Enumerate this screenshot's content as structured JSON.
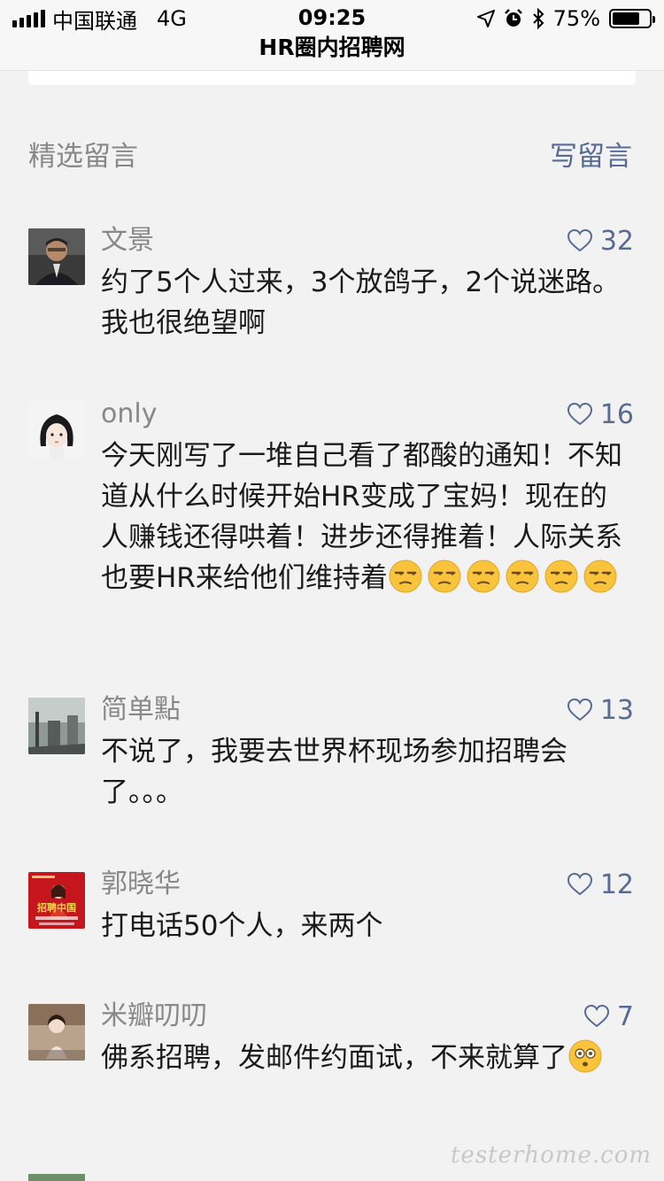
{
  "status_bar": {
    "carrier": "中国联通",
    "network": "4G",
    "time": "09:25",
    "battery": "75%",
    "battery_level": 0.75
  },
  "nav": {
    "title": "HR圈内招聘网"
  },
  "section": {
    "title": "精选留言",
    "write_label": "写留言"
  },
  "comments": [
    {
      "name": "文景",
      "likes": "32",
      "text": "约了5个人过来，3个放鸽子，2个说迷路。我也很绝望啊"
    },
    {
      "name": "only",
      "likes": "16",
      "text": "今天刚写了一堆自己看了都酸的通知！不知道从什么时候开始HR变成了宝妈！现在的人赚钱还得哄着！进步还得推着！人际关系也要HR来给他们维持着",
      "emoji": [
        "unamused-face",
        "unamused-face",
        "unamused-face",
        "unamused-face",
        "unamused-face",
        "unamused-face"
      ]
    },
    {
      "name": "简单點",
      "likes": "13",
      "text": "不说了，我要去世界杯现场参加招聘会了。。。"
    },
    {
      "name": "郭晓华",
      "likes": "12",
      "text": "打电话50个人，来两个",
      "avatar_text": "招聘中国"
    },
    {
      "name": "米瓣叨叨",
      "likes": "7",
      "text": "佛系招聘，发邮件约面试，不来就算了",
      "emoji": [
        "flushed-face"
      ]
    }
  ],
  "watermark": "testerhome.com",
  "colors": {
    "link": "#576b95",
    "muted": "#888888",
    "background": "#f2f2f2"
  }
}
